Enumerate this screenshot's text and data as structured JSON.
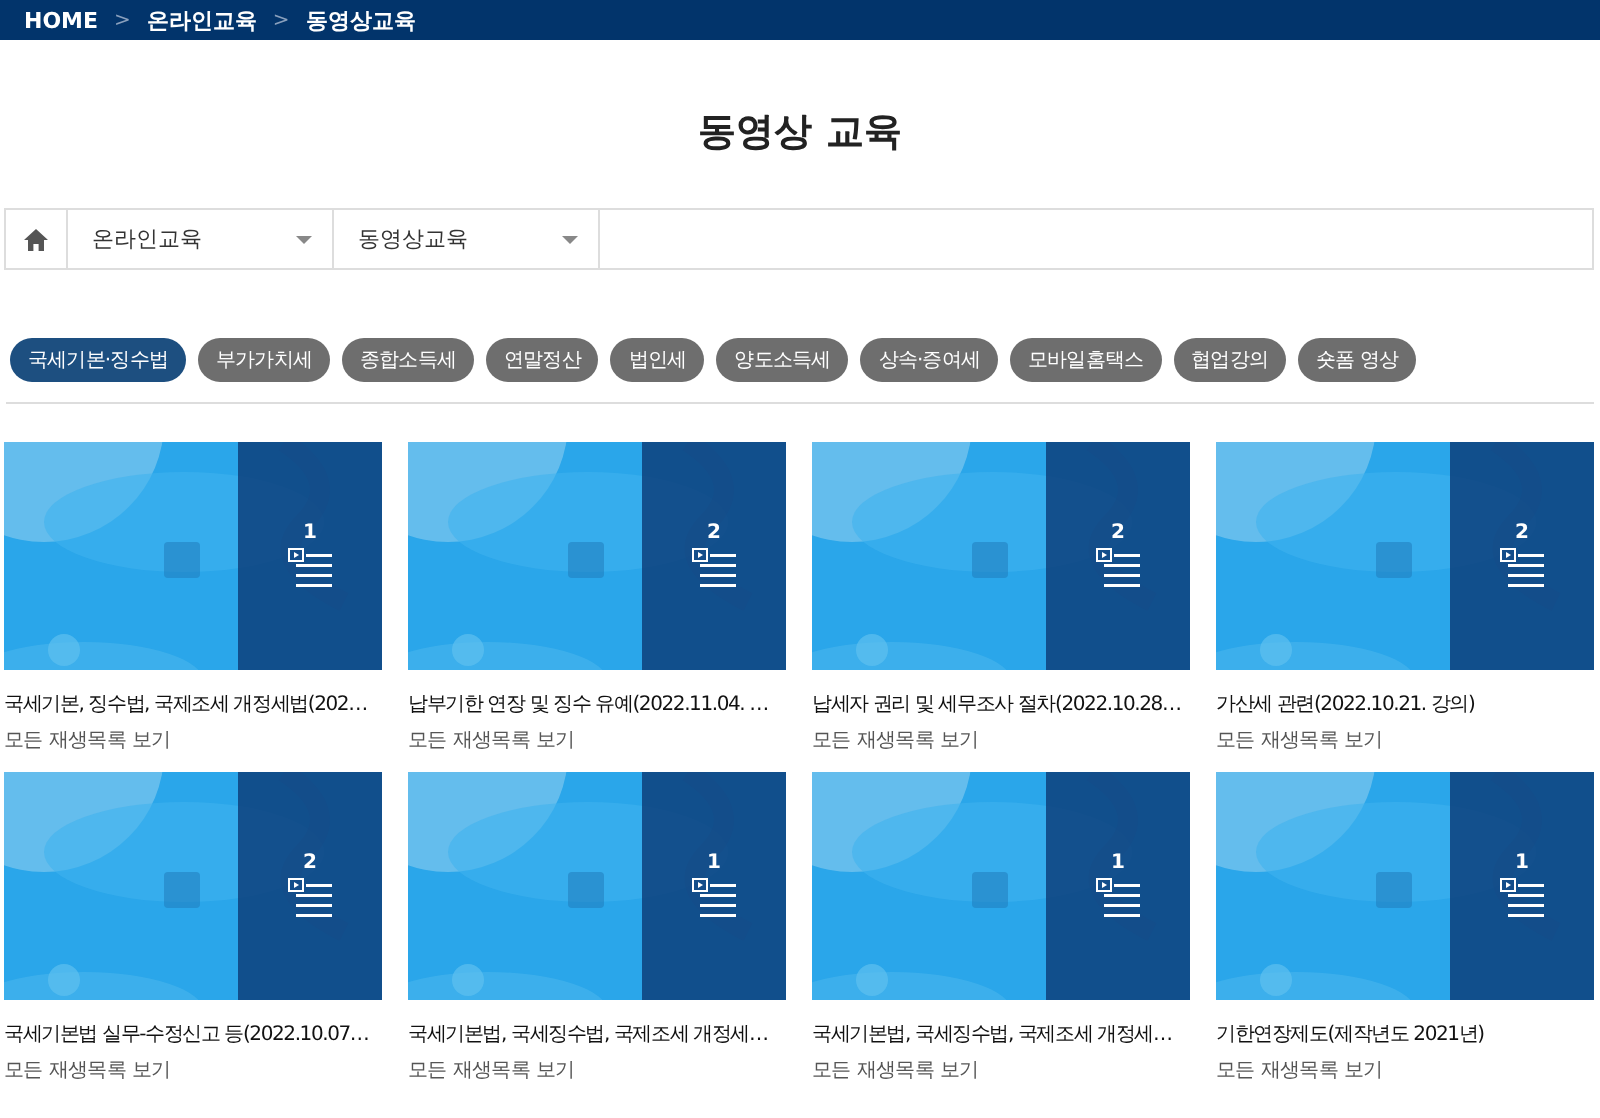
{
  "breadcrumb": [
    "HOME",
    "온라인교육",
    "동영상교육"
  ],
  "breadcrumb_separator": ">",
  "page_title": "동영상 교육",
  "filters": [
    {
      "value": "온라인교육"
    },
    {
      "value": "동영상교육"
    }
  ],
  "categories": [
    {
      "label": "국세기본·징수법",
      "selected": true
    },
    {
      "label": "부가가치세",
      "selected": false
    },
    {
      "label": "종합소득세",
      "selected": false
    },
    {
      "label": "연말정산",
      "selected": false
    },
    {
      "label": "법인세",
      "selected": false
    },
    {
      "label": "양도소득세",
      "selected": false
    },
    {
      "label": "상속·증여세",
      "selected": false
    },
    {
      "label": "모바일홈택스",
      "selected": false
    },
    {
      "label": "협업강의",
      "selected": false
    },
    {
      "label": "숏폼 영상",
      "selected": false
    }
  ],
  "videos": [
    {
      "count": "1",
      "title": "국세기본, 징수법, 국제조세 개정세법(202…",
      "link": "모든 재생목록 보기"
    },
    {
      "count": "2",
      "title": "납부기한 연장 및 징수 유예(2022.11.04. …",
      "link": "모든 재생목록 보기"
    },
    {
      "count": "2",
      "title": "납세자 권리 및 세무조사 절차(2022.10.28…",
      "link": "모든 재생목록 보기"
    },
    {
      "count": "2",
      "title": "가산세 관련(2022.10.21. 강의)",
      "link": "모든 재생목록 보기"
    },
    {
      "count": "2",
      "title": "국세기본법 실무-수정신고 등(2022.10.07…",
      "link": "모든 재생목록 보기"
    },
    {
      "count": "1",
      "title": "국세기본법, 국세징수법, 국제조세 개정세…",
      "link": "모든 재생목록 보기"
    },
    {
      "count": "1",
      "title": "국세기본법, 국세징수법, 국제조세 개정세…",
      "link": "모든 재생목록 보기"
    },
    {
      "count": "1",
      "title": "기한연장제도(제작년도 2021년)",
      "link": "모든 재생목록 보기"
    }
  ]
}
